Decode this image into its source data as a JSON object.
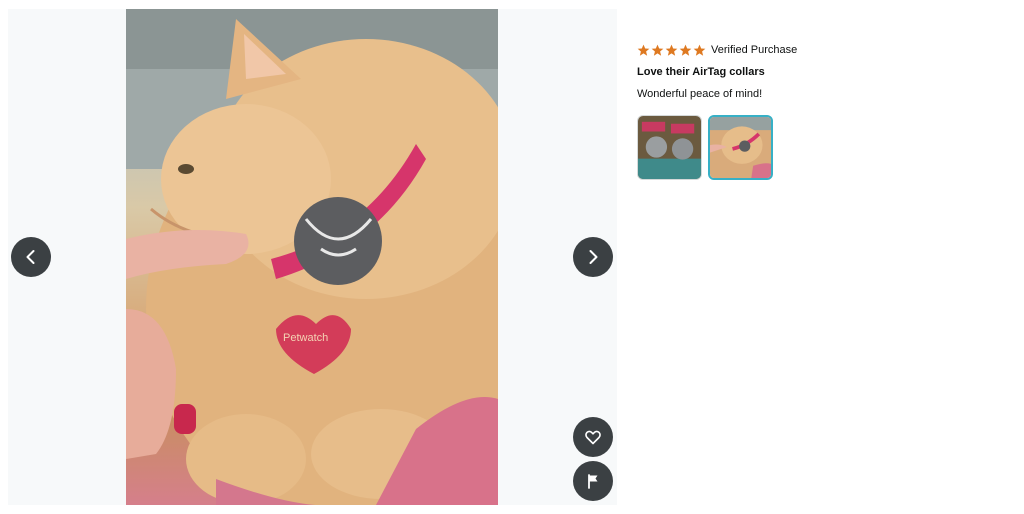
{
  "viewer": {
    "prev_icon": "chevron-left-icon",
    "next_icon": "chevron-right-icon",
    "like_icon": "heart-icon",
    "report_icon": "flag-icon",
    "photo_tag_text": "Petwatch"
  },
  "review": {
    "rating": 5,
    "rating_max": 5,
    "star_color": "#de7921",
    "verified_label": "Verified Purchase",
    "title": "Love their AirTag collars",
    "body": "Wonderful peace of mind!",
    "thumbnails": [
      {
        "selected": false
      },
      {
        "selected": true
      }
    ],
    "selected_border_color": "#37b0c6"
  }
}
